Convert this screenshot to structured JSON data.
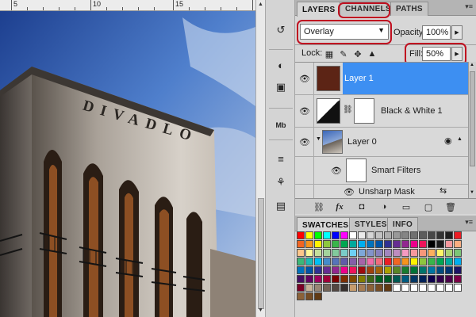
{
  "ruler": {
    "labels": [
      "5",
      "10",
      "15"
    ]
  },
  "photo": {
    "sign_text": "DIVADLO"
  },
  "layers_panel": {
    "tabs": [
      "LAYERS",
      "CHANNELS",
      "PATHS"
    ],
    "active_tab": "LAYERS",
    "blend_mode": "Overlay",
    "opacity_label": "Opacity:",
    "opacity_value": "100%",
    "lock_label": "Lock:",
    "fill_label": "Fill:",
    "fill_value": "50%",
    "layers": [
      {
        "name": "Layer 1",
        "selected": true,
        "thumb": "#5c2415"
      },
      {
        "name": "Black & White 1",
        "selected": false,
        "thumb": "adjustment"
      },
      {
        "name": "Layer 0",
        "selected": false,
        "thumb": "photo"
      },
      {
        "name": "Smart Filters",
        "selected": false,
        "thumb": "white"
      },
      {
        "name": "Unsharp Mask",
        "selected": false,
        "thumb": "none"
      }
    ],
    "footer_icons": [
      "link-icon",
      "fx-icon",
      "mask-icon",
      "adjustment-icon",
      "group-icon",
      "new-layer-icon",
      "trash-icon"
    ]
  },
  "swatches_panel": {
    "tabs": [
      "SWATCHES",
      "STYLES",
      "INFO"
    ],
    "active_tab": "SWATCHES",
    "rows": [
      [
        "#ff0000",
        "#ffff00",
        "#00ff00",
        "#00ffff",
        "#0000ff",
        "#ff00ff",
        "#ffffff",
        "#ebebeb",
        "#d6d6d6",
        "#c2c2c2",
        "#adadad",
        "#999999",
        "#858585",
        "#707070",
        "#5c5c5c",
        "#474747",
        "#333333",
        "#1f1f1f",
        "#ed1c24"
      ],
      [
        "#f26522",
        "#f7941d",
        "#fff200",
        "#8dc63f",
        "#39b54a",
        "#00a651",
        "#00a99d",
        "#00aeef",
        "#0072bc",
        "#0054a6",
        "#2e3192",
        "#662d91",
        "#92278f",
        "#ec008c",
        "#ed145b",
        "#000000",
        "#1a1a1a",
        "#f5989d",
        "#f9ad81"
      ],
      [
        "#fdc68a",
        "#fff799",
        "#c4df9b",
        "#a3d39c",
        "#82ca9c",
        "#7accc8",
        "#6dcff6",
        "#7da7d9",
        "#8393ca",
        "#8781bd",
        "#a186be",
        "#bd8cbf",
        "#f49ac1",
        "#f6989d",
        "#f7977a",
        "#fbaf5d",
        "#fff568",
        "#acd373",
        "#7cc576"
      ],
      [
        "#3cb878",
        "#1cbbb4",
        "#00bff3",
        "#448ccb",
        "#5674b9",
        "#605ca8",
        "#855fa8",
        "#a763a8",
        "#f06eaa",
        "#f26d7d",
        "#ed1c24",
        "#f26522",
        "#f7941d",
        "#fff200",
        "#8dc63f",
        "#39b54a",
        "#00a651",
        "#00a99d",
        "#00aeef"
      ],
      [
        "#0072bc",
        "#0054a6",
        "#2e3192",
        "#662d91",
        "#92278f",
        "#ec008c",
        "#ed145b",
        "#9e0b0f",
        "#a0410d",
        "#a3620a",
        "#aba000",
        "#598527",
        "#197b30",
        "#007236",
        "#00746b",
        "#0076a3",
        "#004b80",
        "#003471",
        "#1b1464"
      ],
      [
        "#440e62",
        "#630460",
        "#9e005d",
        "#9e0039",
        "#790000",
        "#7b2e00",
        "#7d4900",
        "#827b00",
        "#406618",
        "#005e20",
        "#005826",
        "#005952",
        "#005b7f",
        "#003663",
        "#002157",
        "#0d004c",
        "#32004b",
        "#4b0049",
        "#7b0046"
      ],
      [
        "#7a0026",
        "#c7b299",
        "#998675",
        "#736357",
        "#534741",
        "#37302d",
        "#c69c6d",
        "#a67c52",
        "#8c6239",
        "#754c24",
        "#603913",
        "#ffffff",
        "#ffffff",
        "#ffffff",
        "#ffffff",
        "#ffffff",
        "#ffffff",
        "#ffffff",
        "#ffffff"
      ],
      [
        "#8c6239",
        "#754c24",
        "#603913"
      ]
    ]
  }
}
